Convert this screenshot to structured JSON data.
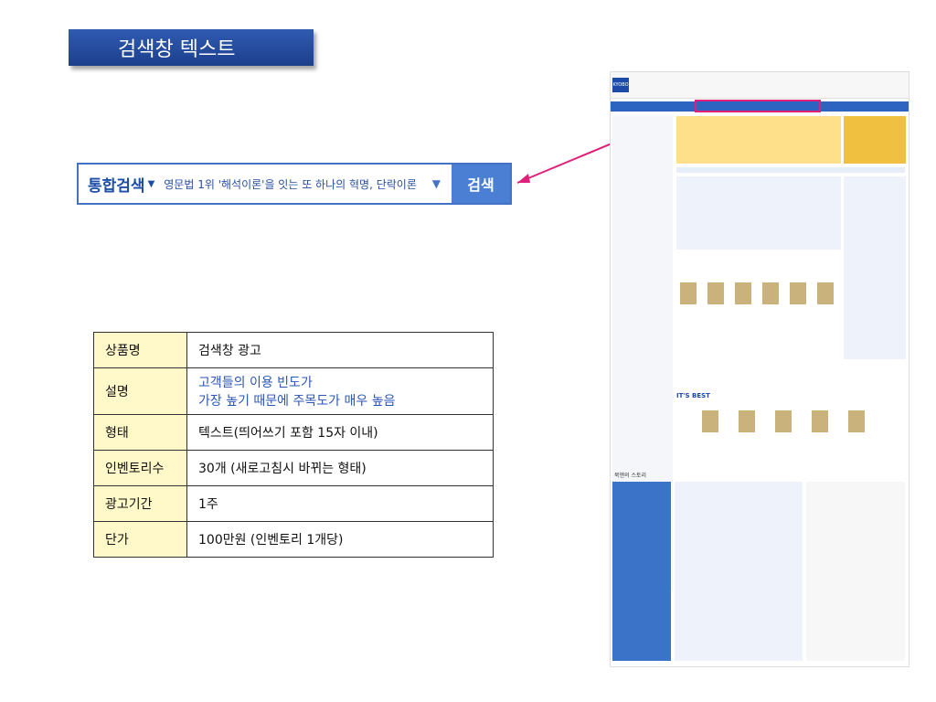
{
  "title": "검색창 텍스트",
  "searchbar": {
    "scope": "통합검색",
    "query": "영문법 1위 '해석이론'을 잇는 또 하나의 혁명, 단락이론",
    "button": "검색"
  },
  "table": [
    {
      "key": "상품명",
      "value": "검색창 광고"
    },
    {
      "key": "설명",
      "value_lines": [
        "고객들의 이용 빈도가",
        "가장 높기 때문에 주목도가 매우 높음"
      ]
    },
    {
      "key": "형태",
      "value": "텍스트(띄어쓰기 포함 15자 이내)"
    },
    {
      "key": "인벤토리수",
      "value": "30개 (새로고침시 바뀌는 형태)"
    },
    {
      "key": "광고기간",
      "value": "1주"
    },
    {
      "key": "단가",
      "value": "100만원 (인벤토리 1개당)"
    }
  ],
  "screenshot": {
    "logo": "KYOBO",
    "section_best": "IT'S BEST",
    "section_story": "북앤의 스토리"
  },
  "colors": {
    "title_bg": "#2a52a8",
    "highlight": "#e0207a",
    "search_border": "#4472c4",
    "key_cell": "#fff8c8"
  }
}
